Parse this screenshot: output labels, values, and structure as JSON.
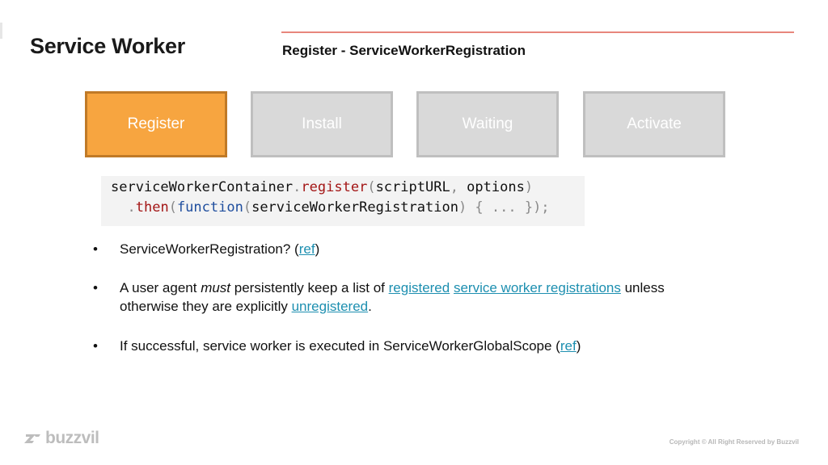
{
  "header": {
    "title": "Service Worker",
    "subtitle": "Register - ServiceWorkerRegistration"
  },
  "steps": [
    {
      "label": "Register",
      "active": true
    },
    {
      "label": "Install",
      "active": false
    },
    {
      "label": "Waiting",
      "active": false
    },
    {
      "label": "Activate",
      "active": false
    }
  ],
  "code": {
    "line1": {
      "obj": "serviceWorkerContainer",
      "dot": ".",
      "method": "register",
      "open": "(",
      "args": "scriptURL",
      "comma": ", ",
      "arg2": "options",
      "close": ")"
    },
    "line2": {
      "indent": "  ",
      "dot": ".",
      "method": "then",
      "open": "(",
      "kw": "function",
      "open2": "(",
      "param": "serviceWorkerRegistration",
      "rest": ") { ... });"
    }
  },
  "bullets": {
    "b1": {
      "text": "ServiceWorkerRegistration? (",
      "link": "ref",
      "end": ")"
    },
    "b2": {
      "t1": "A user agent ",
      "em": "must",
      "t2": " persistently keep a list of ",
      "link1": "registered",
      "t3": " ",
      "link2": "service worker registrations",
      "t4": " unless otherwise they are explicitly ",
      "link3": "unregistered",
      "t5": "."
    },
    "b3": {
      "text": "If successful, service worker is executed in ServiceWorkerGlobalScope (",
      "link": "ref",
      "end": ")"
    }
  },
  "footer": {
    "logo": "buzzvil",
    "copyright": "Copyright © All Right Reserved by Buzzvil"
  },
  "colors": {
    "active_step": "#f7a540",
    "inactive_step": "#d9d9d9",
    "link": "#1d8fb0",
    "accent_line": "#e8867c"
  }
}
